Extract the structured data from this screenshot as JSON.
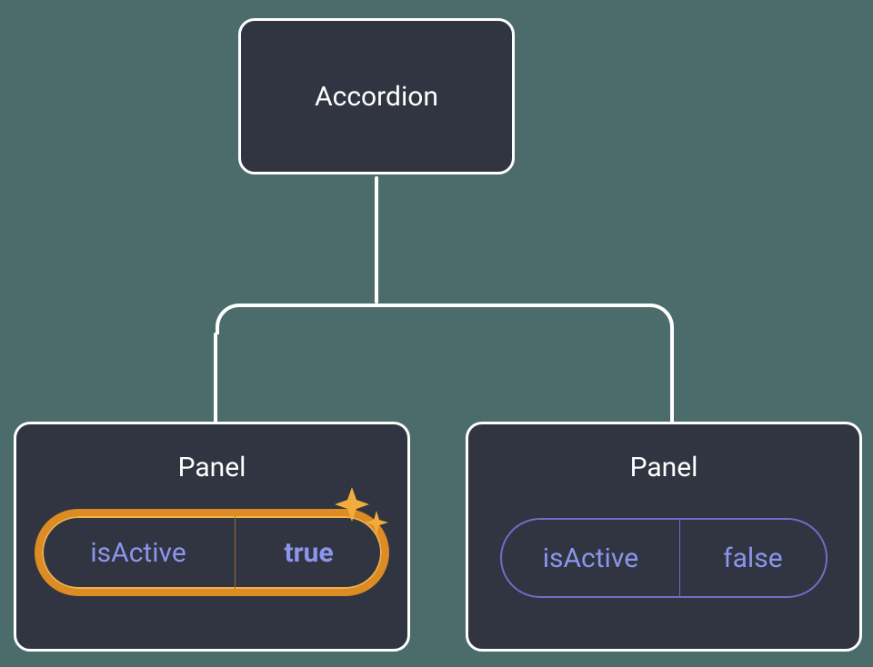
{
  "parent": {
    "label": "Accordion"
  },
  "children": [
    {
      "title": "Panel",
      "prop": "isActive",
      "value": "true",
      "active": true
    },
    {
      "title": "Panel",
      "prop": "isActive",
      "value": "false",
      "active": false
    }
  ],
  "colors": {
    "background": "#4c6c6c",
    "nodeFill": "#303541",
    "nodeBorder": "#ffffff",
    "propText": "#8d94ec",
    "activePillBorder": "#dd8b23",
    "activePillHighlight": "#f2b14a",
    "inactivePillBorder": "#6b6fc8"
  }
}
